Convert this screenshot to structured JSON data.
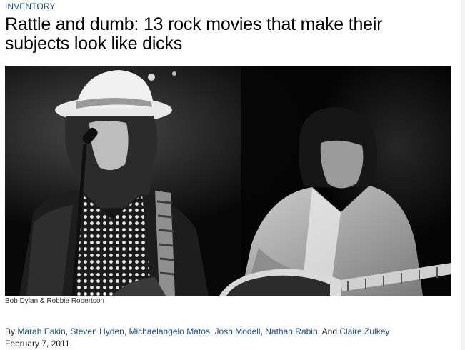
{
  "section": {
    "label": "INVENTORY",
    "color": "#1a4f9c"
  },
  "article": {
    "headline_line1": "Rattle and dumb: 13 rock movies that make their",
    "headline_line2": "subjects look like dicks",
    "photo_description": "black-and-white concert photo of two musicians",
    "photo_caption": "Bob Dylan & Robbie Robertson",
    "byline_prefix": "By",
    "authors": [
      "Marah Eakin",
      "Steven Hyden",
      "Michaelangelo Matos",
      "Josh Modell",
      "Nathan Rabin",
      "Claire Zulkey"
    ],
    "byline_conjunction": "And",
    "date": "February 7, 2011",
    "link_color": "#1a4f9c"
  }
}
